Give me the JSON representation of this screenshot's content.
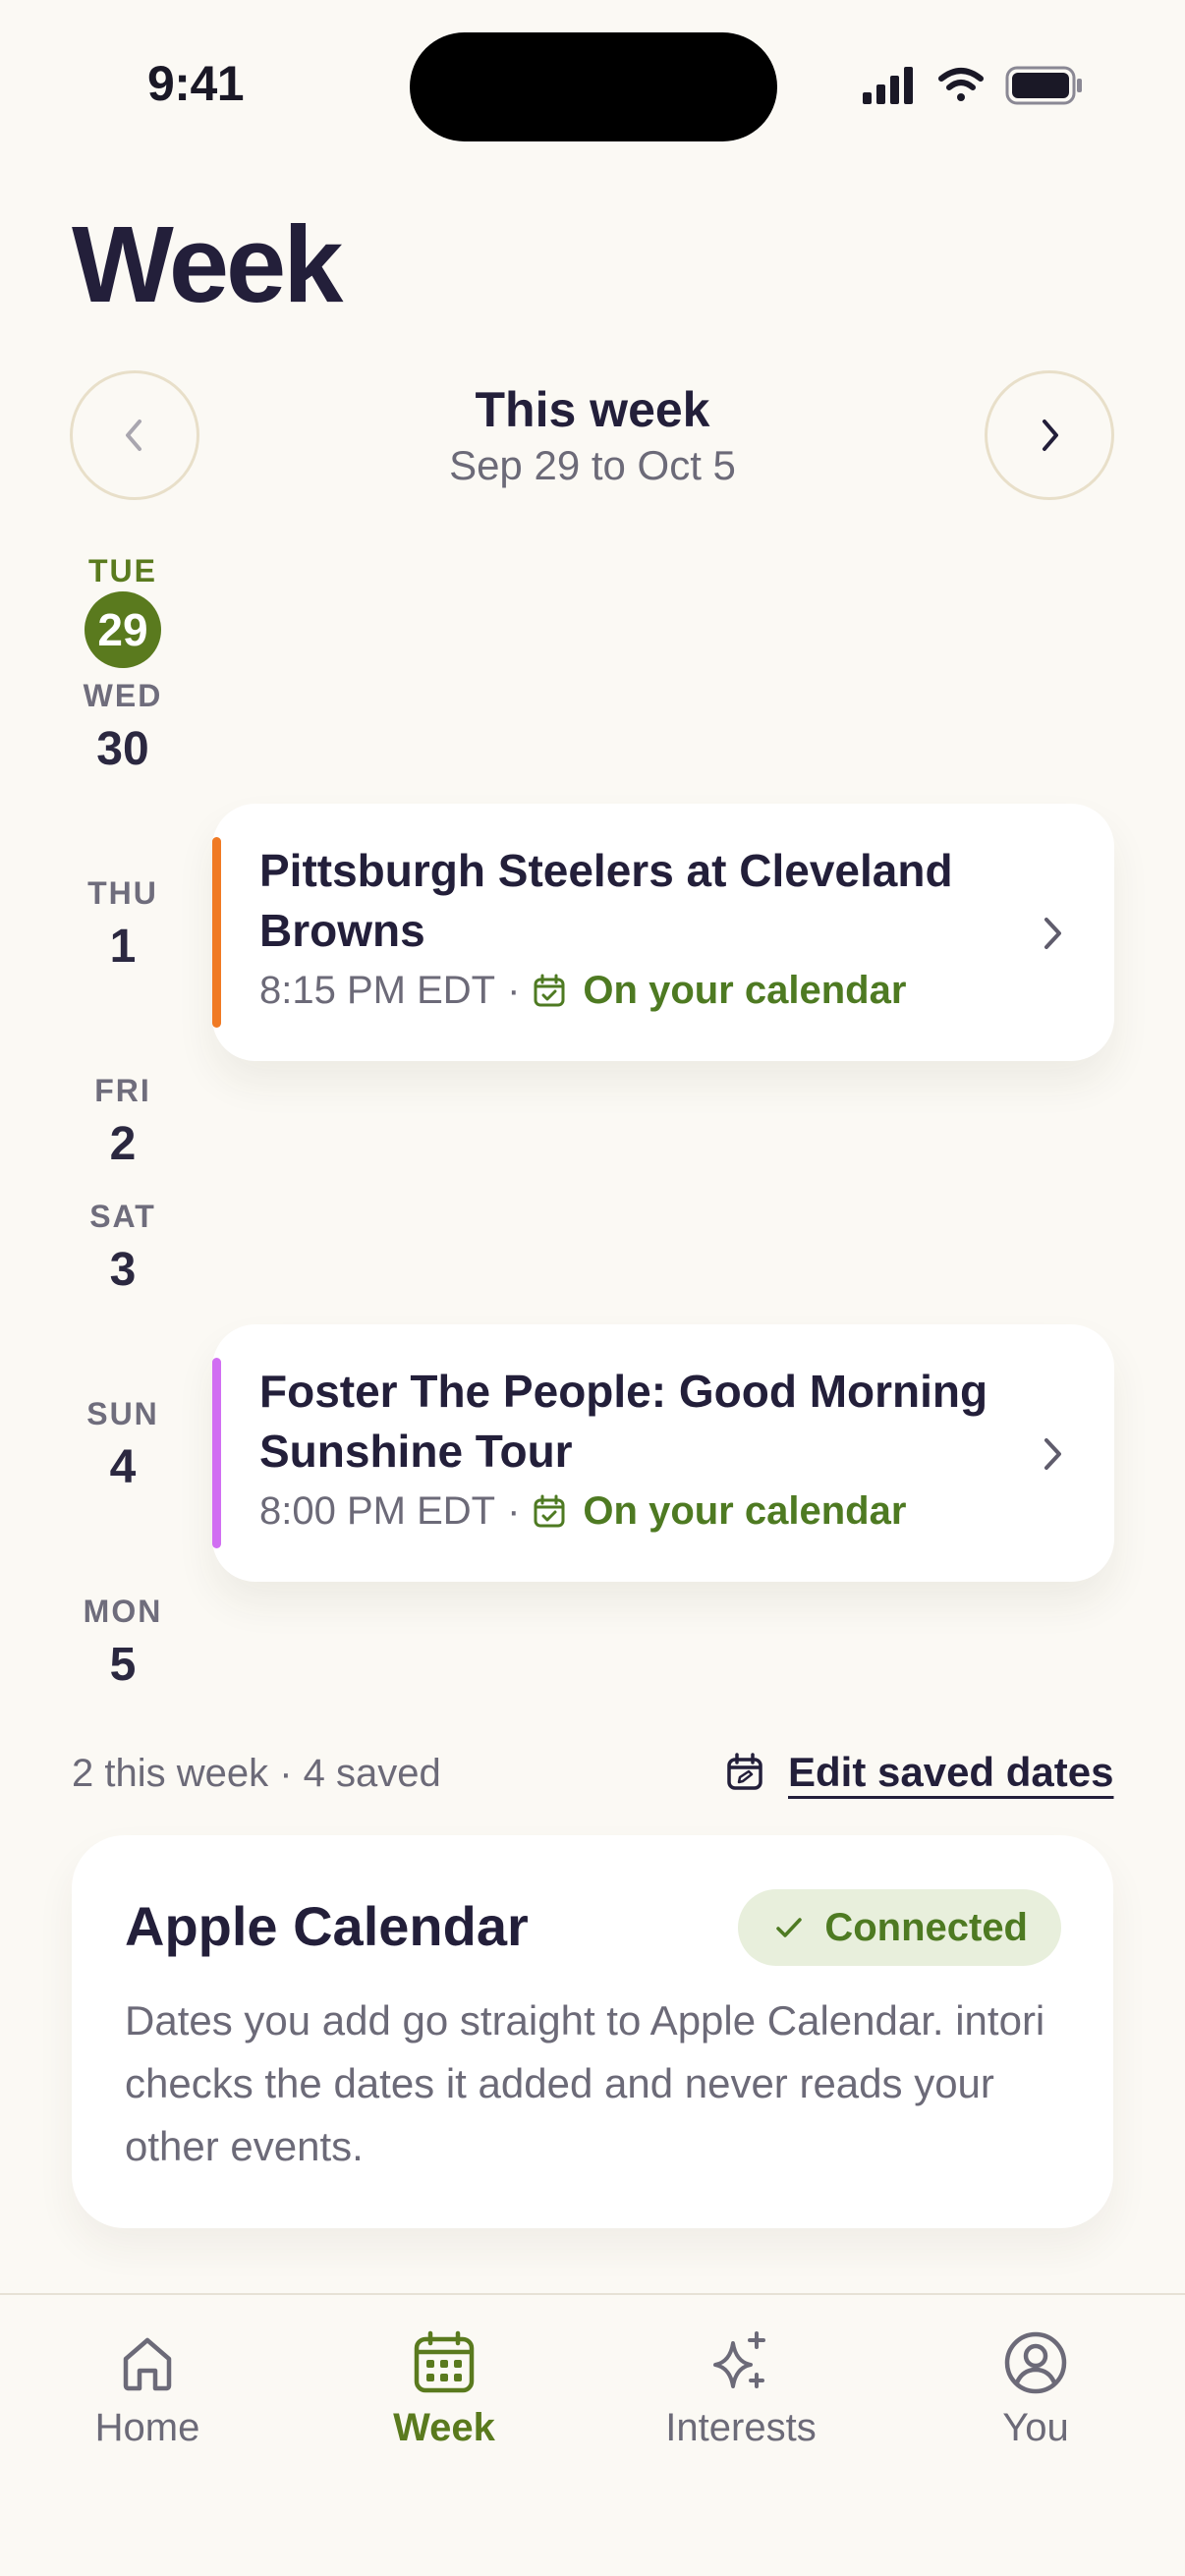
{
  "status_bar": {
    "time": "9:41"
  },
  "page": {
    "title": "Week"
  },
  "week_nav": {
    "heading": "This week",
    "range": "Sep 29 to Oct 5",
    "prev_icon": "chevron-left-icon",
    "next_icon": "chevron-right-icon"
  },
  "days": [
    {
      "name": "TUE",
      "number": "29",
      "today": true
    },
    {
      "name": "WED",
      "number": "30"
    },
    {
      "name": "THU",
      "number": "1"
    },
    {
      "name": "FRI",
      "number": "2"
    },
    {
      "name": "SAT",
      "number": "3"
    },
    {
      "name": "SUN",
      "number": "4"
    },
    {
      "name": "MON",
      "number": "5"
    }
  ],
  "events": [
    {
      "title": "Pittsburgh Steelers at Cleveland Browns",
      "time": "8:15 PM EDT",
      "calendar_status": "On your calendar",
      "accent_color": "#F07A24"
    },
    {
      "title": "Foster The People: Good Morning Sunshine Tour",
      "time": "8:00 PM EDT",
      "calendar_status": "On your calendar",
      "accent_color": "#D16EF2"
    }
  ],
  "summary": {
    "text": "2 this week · 4 saved",
    "edit_label": "Edit saved dates"
  },
  "calendar_card": {
    "title": "Apple Calendar",
    "status": "Connected",
    "description": "Dates you add go straight to Apple Calendar. intori checks the dates it added and never reads your other events."
  },
  "tab_bar": {
    "tabs": [
      {
        "label": "Home",
        "icon": "home-icon"
      },
      {
        "label": "Week",
        "icon": "calendar-icon",
        "active": true
      },
      {
        "label": "Interests",
        "icon": "sparkles-icon"
      },
      {
        "label": "You",
        "icon": "user-circle-icon"
      }
    ]
  },
  "colors": {
    "background": "#FBF9F4",
    "text_primary": "#231F3A",
    "text_secondary": "#6C6A78",
    "accent_green": "#5A7A1E",
    "connected_bg": "#E8EFDC"
  }
}
